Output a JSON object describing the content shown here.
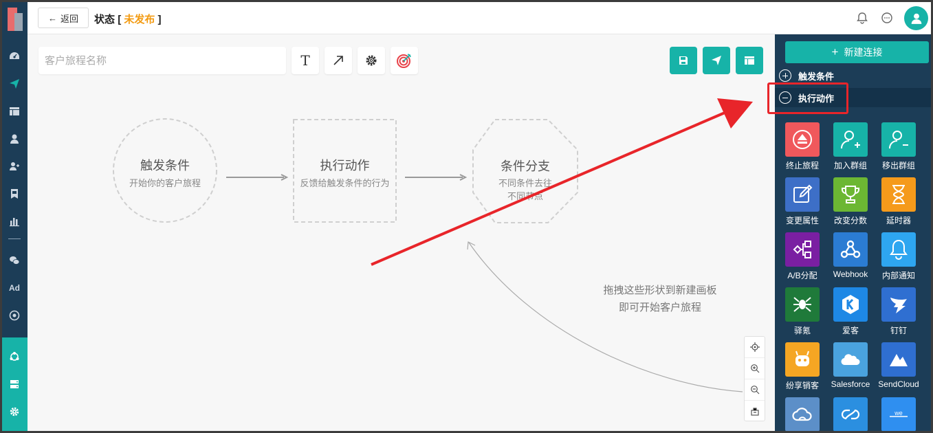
{
  "header": {
    "back_label": "返回",
    "title": "状态",
    "status_open": "[",
    "status": "未发布",
    "status_close": "]"
  },
  "toolbar": {
    "name_placeholder": "客户旅程名称",
    "text_tool": "T"
  },
  "diagram": {
    "trigger_title": "触发条件",
    "trigger_sub": "开始你的客户旅程",
    "action_title": "执行动作",
    "action_sub": "反馈给触发条件的行为",
    "branch_title": "条件分支",
    "branch_sub1": "不同条件去往",
    "branch_sub2": "不同节点",
    "hint_line1": "拖拽这些形状到新建画板",
    "hint_line2": "即可开始客户旅程"
  },
  "panel": {
    "new_connection": "新建连接",
    "section_trigger": "触发条件",
    "section_action": "执行动作",
    "tiles": [
      {
        "label": "终止旅程",
        "color": "#f0585c",
        "icon": "eject-icon"
      },
      {
        "label": "加入群组",
        "color": "#17b3a8",
        "icon": "user-add-icon"
      },
      {
        "label": "移出群组",
        "color": "#17b3a8",
        "icon": "user-remove-icon"
      },
      {
        "label": "变更属性",
        "color": "#3d6fc7",
        "icon": "edit-icon"
      },
      {
        "label": "改变分数",
        "color": "#6cb733",
        "icon": "trophy-icon"
      },
      {
        "label": "延时器",
        "color": "#f59a1b",
        "icon": "hourglass-icon"
      },
      {
        "label": "A/B分配",
        "color": "#7a1fa2",
        "icon": "ab-split-icon"
      },
      {
        "label": "Webhook",
        "color": "#2b7cd3",
        "icon": "webhook-icon"
      },
      {
        "label": "内部通知",
        "color": "#2ea6f0",
        "icon": "bell-icon"
      },
      {
        "label": "驿氪",
        "color": "#1f7a3a",
        "icon": "spider-icon"
      },
      {
        "label": "爱客",
        "color": "#1e88e5",
        "icon": "k-logo-icon"
      },
      {
        "label": "钉钉",
        "color": "#2f6fd1",
        "icon": "dingtalk-icon"
      },
      {
        "label": "纷享销客",
        "color": "#f5a623",
        "icon": "fxiaoke-icon"
      },
      {
        "label": "Salesforce",
        "color": "#4aa3df",
        "icon": "salesforce-cloud-icon"
      },
      {
        "label": "SendCloud",
        "color": "#2f6fd1",
        "icon": "sendcloud-icon"
      },
      {
        "label": "",
        "color": "#5c8fc8",
        "icon": "cloud-icon"
      },
      {
        "label": "",
        "color": "#2b8fe0",
        "icon": "link-cloud-icon"
      },
      {
        "label": "",
        "color": "#2f8ff0",
        "icon": "wechat-work-icon"
      }
    ]
  }
}
